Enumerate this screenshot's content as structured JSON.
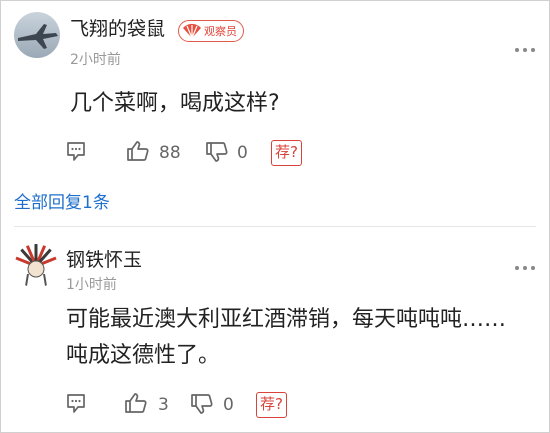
{
  "comments": [
    {
      "username": "飞翔的袋鼠",
      "badge": "观察员",
      "time": "2小时前",
      "text": "几个菜啊，喝成这样?",
      "likes": "88",
      "dislikes": "0",
      "recommend": "荐?"
    },
    {
      "username": "钢铁怀玉",
      "time": "1小时前",
      "text": "可能最近澳大利亚红酒滞销，每天吨吨吨……吨成这德性了。",
      "likes": "3",
      "dislikes": "0",
      "recommend": "荐?"
    }
  ],
  "replies_link": "全部回复1条",
  "colors": {
    "accent_red": "#d8433a",
    "link_blue": "#1e6fcc",
    "meta_gray": "#9a9a9a"
  },
  "icons": [
    "avatar-jet",
    "avatar-headdress",
    "fan-icon",
    "more-icon",
    "comment-icon",
    "thumbs-up-icon",
    "thumbs-down-icon"
  ]
}
